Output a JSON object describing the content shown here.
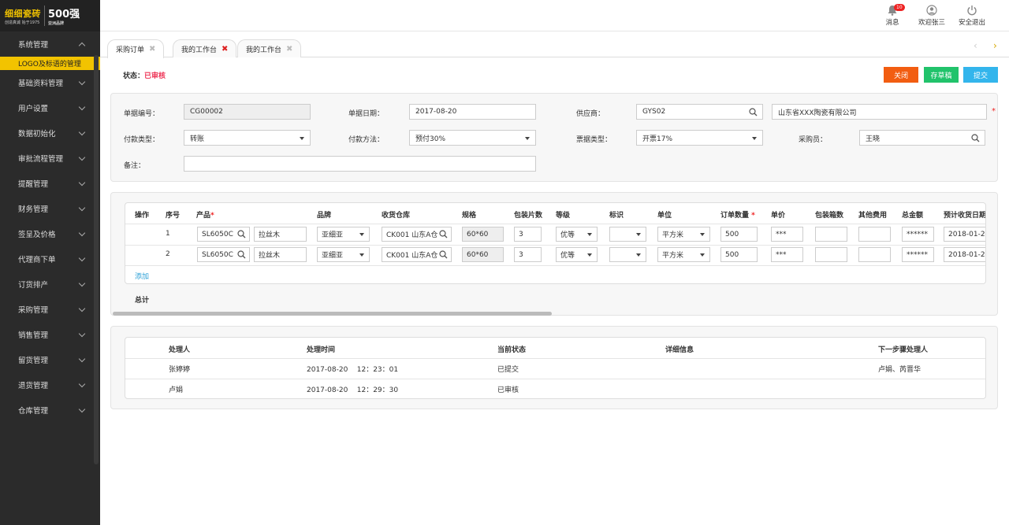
{
  "logo": {
    "brand": "细细瓷砖",
    "slogan": "创造真诚 始于1975",
    "badge": "500强",
    "badge_sub": "亚洲品牌"
  },
  "sidebar": {
    "items": [
      {
        "label": "系统管理"
      },
      {
        "label": "基础资料管理"
      },
      {
        "label": "用户设置"
      },
      {
        "label": "数据初始化"
      },
      {
        "label": "审批流程管理"
      },
      {
        "label": "提醒管理"
      },
      {
        "label": "财务管理"
      },
      {
        "label": "签呈及价格"
      },
      {
        "label": "代理商下单"
      },
      {
        "label": "订货排产"
      },
      {
        "label": "采购管理"
      },
      {
        "label": "销售管理"
      },
      {
        "label": "留货管理"
      },
      {
        "label": "退货管理"
      },
      {
        "label": "仓库管理"
      }
    ],
    "active_sub": "LOGO及标语的管理"
  },
  "header": {
    "messages": "消息",
    "messages_count": "10",
    "welcome": "欢迎张三",
    "logout": "安全退出"
  },
  "tabs": [
    {
      "label": "采购订单"
    },
    {
      "label": "我的工作台"
    },
    {
      "label": "我的工作台"
    }
  ],
  "status": {
    "label": "状态：",
    "value": "已审核"
  },
  "actions": {
    "close": "关闭",
    "draft": "存草稿",
    "submit": "提交",
    "close_color": "#f25d11",
    "draft_color": "#21c36b",
    "submit_color": "#33b5ec"
  },
  "form": {
    "doc_no_label": "单据编号：",
    "doc_no": "CG00002",
    "doc_date_label": "单据日期：",
    "doc_date": "2017-08-20",
    "supplier_label": "供应商：",
    "supplier_code": "GYS02",
    "supplier_name": "山东省XXX陶瓷有限公司",
    "pay_type_label": "付款类型：",
    "pay_type": "转账",
    "pay_method_label": "付款方法：",
    "pay_method": "预付30%",
    "invoice_label": "票据类型：",
    "invoice": "开票17%",
    "buyer_label": "采购员：",
    "buyer": "王晓",
    "remark_label": "备注：",
    "remark": ""
  },
  "order_table": {
    "headers": [
      "操作",
      "序号",
      "产品",
      "品牌",
      "收货仓库",
      "规格",
      "包装片数",
      "等级",
      "标识",
      "单位",
      "订单数量",
      "单价",
      "包装箱数",
      "其他费用",
      "总金额",
      "预计收货日期"
    ],
    "rows": [
      {
        "seq": "1",
        "product_code": "SL6050C",
        "product_name": "拉丝木",
        "brand": "亚细亚",
        "warehouse": "CK001 山东A仓",
        "spec": "60*60",
        "pieces": "3",
        "grade": "优等",
        "mark": "",
        "unit": "平方米",
        "qty": "500",
        "price": "***",
        "boxes": "",
        "other_fee": "",
        "total": "******",
        "eta": "2018-01-2"
      },
      {
        "seq": "2",
        "product_code": "SL6050C",
        "product_name": "拉丝木",
        "brand": "亚细亚",
        "warehouse": "CK001 山东A仓",
        "spec": "60*60",
        "pieces": "3",
        "grade": "优等",
        "mark": "",
        "unit": "平方米",
        "qty": "500",
        "price": "***",
        "boxes": "",
        "other_fee": "",
        "total": "******",
        "eta": "2018-01-2"
      }
    ],
    "add_label": "添加",
    "total_label": "总计"
  },
  "process_table": {
    "headers": [
      "处理人",
      "处理时间",
      "当前状态",
      "详细信息",
      "下一步骤处理人"
    ],
    "rows": [
      {
        "person": "张婷婷",
        "time": "2017-08-20    12：23：01",
        "state": "已提交",
        "detail": "",
        "next": "卢娟、芮晋华"
      },
      {
        "person": "卢娟",
        "time": "2017-08-20    12：29：30",
        "state": "已审核",
        "detail": "",
        "next": ""
      }
    ]
  }
}
